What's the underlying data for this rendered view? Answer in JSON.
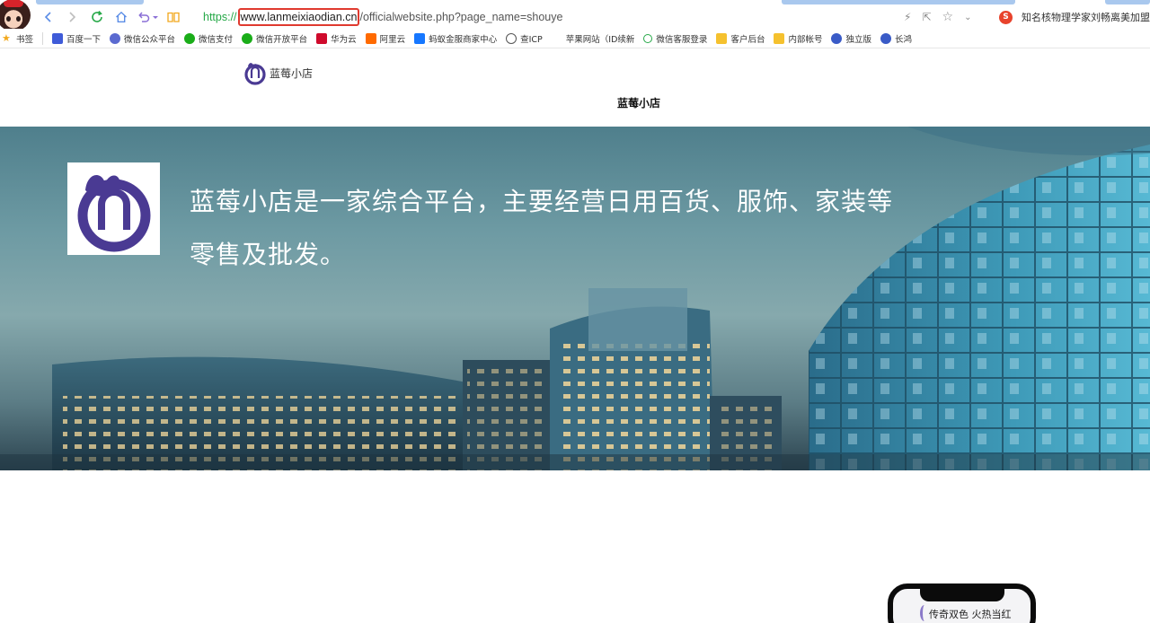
{
  "browser": {
    "url": {
      "scheme": "https://",
      "host": "www.lanmeixiaodian.cn",
      "path": "/officialwebsite.php?page_name=shouye"
    },
    "search_hint": "知名核物理学家刘畅离美加盟北大",
    "bookmarks": [
      {
        "label": "书签",
        "icon": "star-icon",
        "color": "#f2a81d"
      },
      {
        "label": "百度一下",
        "icon": "baidu-paw-icon",
        "color": "#3f5bd8"
      },
      {
        "label": "微信公众平台",
        "icon": "wechat-mp-icon",
        "color": "#5b6ad0"
      },
      {
        "label": "微信支付",
        "icon": "wechat-pay-icon",
        "color": "#1aad19"
      },
      {
        "label": "微信开放平台",
        "icon": "wechat-open-icon",
        "color": "#1aad19"
      },
      {
        "label": "华为云",
        "icon": "huawei-icon",
        "color": "#cf0a2c"
      },
      {
        "label": "阿里云",
        "icon": "aliyun-icon",
        "color": "#ff6a00"
      },
      {
        "label": "蚂蚁金服商家中心",
        "icon": "alipay-icon",
        "color": "#1677ff"
      },
      {
        "label": "查ICP",
        "icon": "globe-icon",
        "color": "#555555"
      },
      {
        "label": "苹果网站（ID续新",
        "icon": "apple-icon",
        "color": "#333333"
      },
      {
        "label": "微信客服登录",
        "icon": "refresh-green-icon",
        "color": "#25a847"
      },
      {
        "label": "客户后台",
        "icon": "folder-icon",
        "color": "#f5c12e"
      },
      {
        "label": "内部帐号",
        "icon": "folder-icon",
        "color": "#f5c12e"
      },
      {
        "label": "独立版",
        "icon": "s-logo-icon",
        "color": "#3a5bc7"
      },
      {
        "label": "长鸿",
        "icon": "s-logo-icon",
        "color": "#3a5bc7"
      }
    ]
  },
  "site": {
    "logo_text": "蓝莓小店",
    "nav_title": "蓝莓小店",
    "hero_text": "蓝莓小店是一家综合平台，主要经营日用百货、服饰、家装等零售及批发。",
    "phone_caption": "传奇双色 火热当红",
    "brand_color": "#4a3a93"
  }
}
